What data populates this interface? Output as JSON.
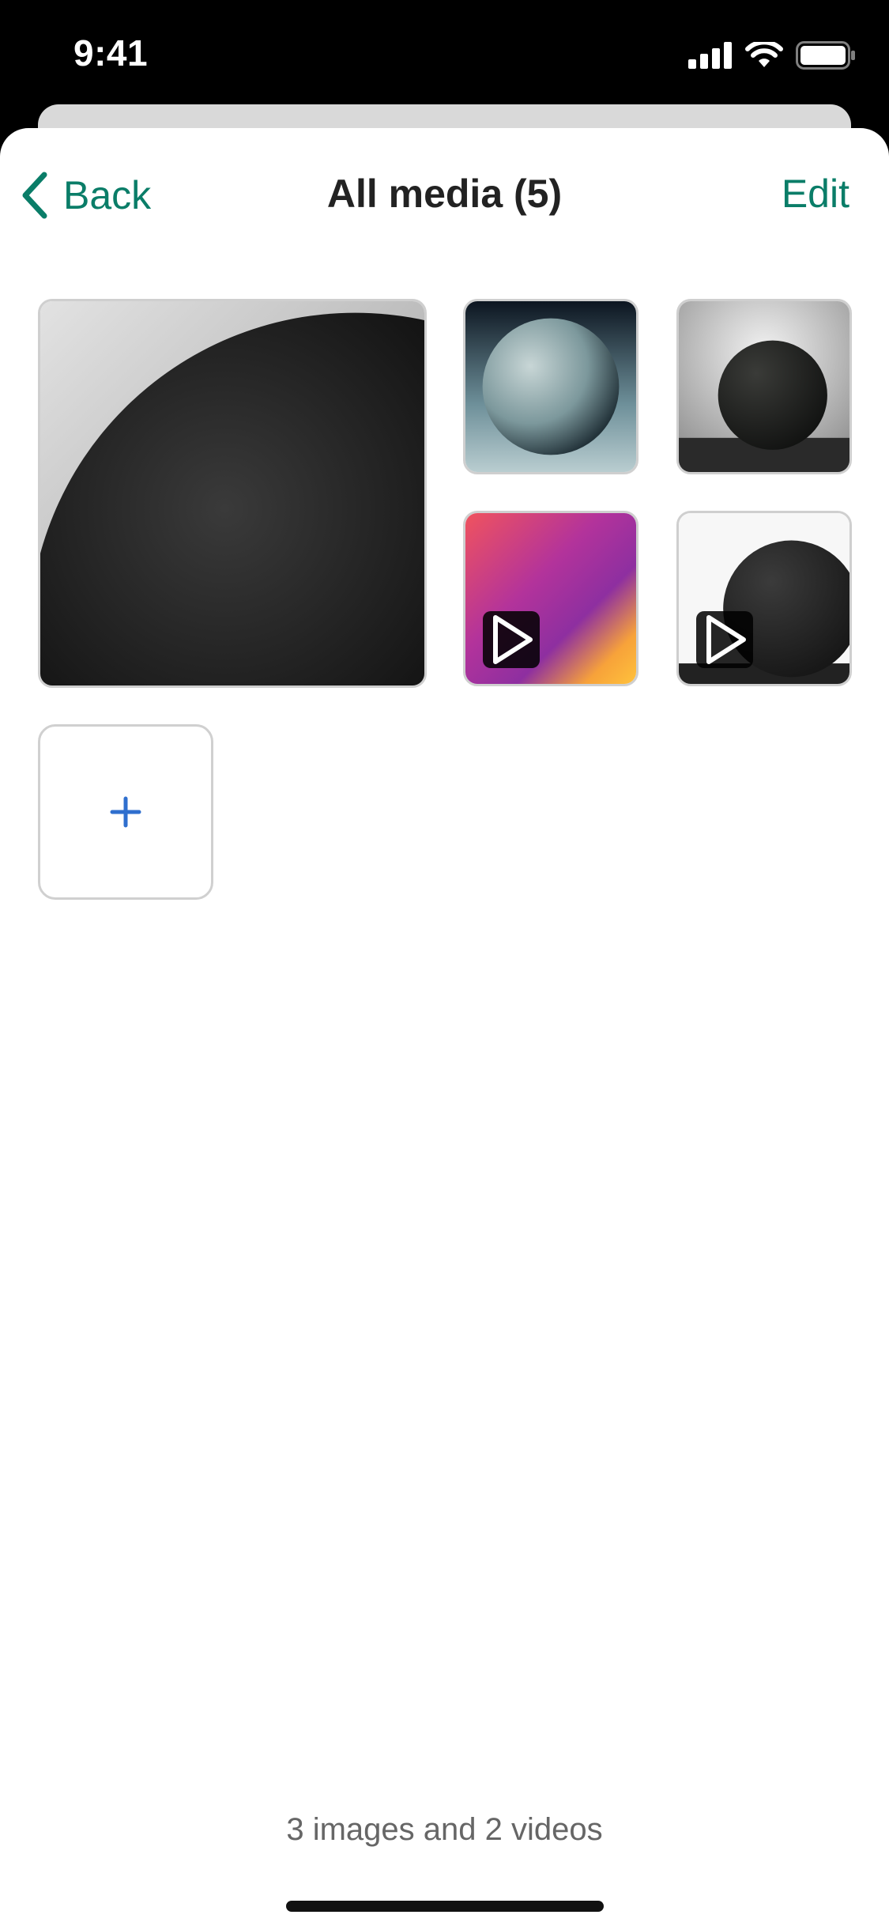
{
  "status_bar": {
    "time": "9:41"
  },
  "nav": {
    "back_label": "Back",
    "title": "All media (5)",
    "edit_label": "Edit"
  },
  "media": [
    {
      "kind": "image",
      "name": "media-item-1"
    },
    {
      "kind": "image",
      "name": "media-item-2"
    },
    {
      "kind": "image",
      "name": "media-item-3"
    },
    {
      "kind": "video",
      "name": "media-item-4"
    },
    {
      "kind": "video",
      "name": "media-item-5"
    }
  ],
  "add_button": {
    "icon": "plus-icon"
  },
  "footer": {
    "summary": "3 images and 2 videos"
  },
  "colors": {
    "accent": "#0a7d68",
    "plus": "#2f6fce"
  }
}
